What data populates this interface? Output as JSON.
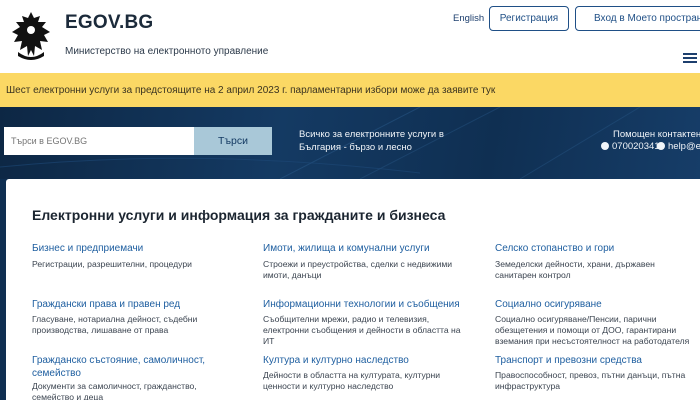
{
  "header": {
    "site_title": "EGOV.BG",
    "site_subtitle": "Министерство на електронното управление",
    "language_link": "English",
    "register_label": "Регистрация",
    "login_label": "Вход в Моето пространство"
  },
  "alert": {
    "text": "Шест електронни услуги за предстоящите на 2 април 2023 г. парламентарни избори може да заявите тук"
  },
  "search": {
    "placeholder": "Търси в EGOV.BG",
    "button_label": "Търси"
  },
  "hero": {
    "tagline_line1": "Всичко за електронните услуги в",
    "tagline_line2": "България - бързо и лесно",
    "help_title": "Помощен контактен ц",
    "help_phone": "070020341",
    "help_email": "help@e"
  },
  "main": {
    "section_title": "Електронни услуги и информация за гражданите и бизнеса",
    "categories": [
      {
        "title": "Бизнес и предприемачи",
        "desc_lines": [
          "Регистрации, разрешителни, процедури"
        ]
      },
      {
        "title": "Имоти, жилища и комунални услуги",
        "desc_lines": [
          "Строежи и преустройства, сделки с недвижими",
          "имоти, данъци"
        ]
      },
      {
        "title": "Селско стопанство и гори",
        "desc_lines": [
          "Земеделски дейности, храни, държавен",
          "санитарен контрол"
        ]
      },
      {
        "title": "Граждански права и правен ред",
        "desc_lines": [
          "Гласуване, нотариална дейност, съдебни",
          "производства, лишаване от права"
        ]
      },
      {
        "title": "Информационни технологии и съобщения",
        "desc_lines": [
          "Съобщителни мрежи, радио и телевизия,",
          "електронни съобщения и дейности в областта на",
          "ИТ"
        ]
      },
      {
        "title": "Социално осигуряване",
        "desc_lines": [
          "Социално осигуряване/Пенсии, парични",
          "обезщетения и помощи от ДОО, гарантирани",
          "вземания при несъстоятелност на работодателя"
        ]
      },
      {
        "title": "Гражданско състояние, самоличност,",
        "title2": "семейство",
        "desc_lines": [
          "Документи за самоличност, гражданство,",
          "семейство и деца"
        ]
      },
      {
        "title": "Култура и културно наследство",
        "desc_lines": [
          "Дейности в областта на културата, културни",
          "ценности и културно наследство"
        ]
      },
      {
        "title": "Транспорт и превозни средства",
        "desc_lines": [
          "Правоспособност, превоз, пътни данъци, пътна",
          "инфраструктура"
        ]
      }
    ]
  },
  "colors": {
    "brand_dark": "#0f2f52",
    "link_blue": "#1f5fa0",
    "alert_yellow": "#fbd864",
    "search_button": "#a9c8d8"
  },
  "icons": {
    "logo": "coat-of-arms-lion-icon",
    "menu": "hamburger-menu-icon",
    "phone": "phone-icon",
    "mail": "mail-icon"
  }
}
